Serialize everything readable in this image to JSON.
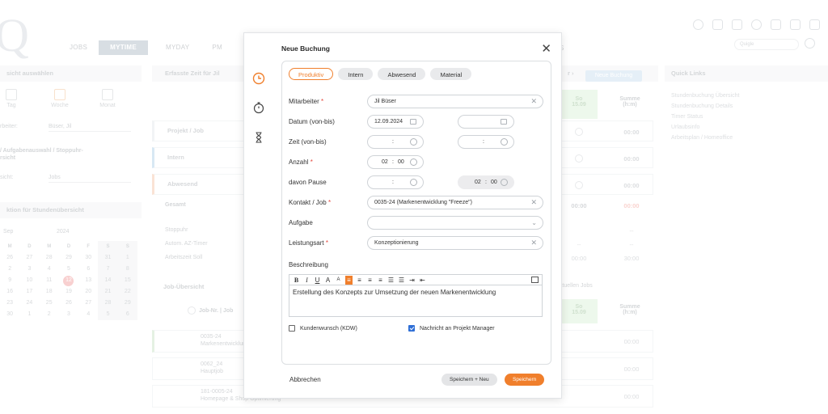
{
  "app": {
    "logo": "Q",
    "nav": [
      "JOBS",
      "MYTIME",
      "MYDAY",
      "PM",
      "S"
    ],
    "quick_search_placeholder": "Quigle"
  },
  "left_panel": {
    "header": "sicht auswählen",
    "views": [
      "Tag",
      "Woche",
      "Monat"
    ],
    "mitarbeiter_label": "rbeiter:",
    "mitarbeiter_value": "Büser, Jil",
    "aufgaben_header": "/ Aufgabenauswahl / Stoppuhr-",
    "aufgaben_sub": "rsicht",
    "ansicht_label": "sicht:",
    "ansicht_value": "Jobs",
    "section_header": "ktion für Stundenübersicht",
    "calendar": {
      "month": "Sep",
      "year": "2024",
      "weekdays": [
        "M",
        "D",
        "M",
        "D",
        "F",
        "S",
        "S"
      ],
      "weeks": [
        [
          "26",
          "27",
          "28",
          "29",
          "30",
          "31",
          "1"
        ],
        [
          "2",
          "3",
          "4",
          "5",
          "6",
          "7",
          "8"
        ],
        [
          "9",
          "10",
          "11",
          "12",
          "13",
          "14",
          "15"
        ],
        [
          "16",
          "17",
          "18",
          "19",
          "20",
          "21",
          "22"
        ],
        [
          "23",
          "24",
          "25",
          "26",
          "27",
          "28",
          "29"
        ],
        [
          "30",
          "1",
          "2",
          "3",
          "4",
          "5",
          "6"
        ]
      ],
      "today": "12"
    }
  },
  "main": {
    "header": "Erfasste Zeit für Jil",
    "nav_arrow": "r ›",
    "neue_buchung_btn": "Neue Buchung",
    "col_so": "So",
    "col_so_date": "15.09",
    "col_summe": "Summe",
    "col_summe_unit": "(h:m)",
    "rows": [
      {
        "label": "Projekt / Job",
        "so": "",
        "sum": "00:00"
      },
      {
        "label": "Intern",
        "so": "",
        "sum": "00:00"
      },
      {
        "label": "Abwesend",
        "so": "",
        "sum": "00:00"
      }
    ],
    "gesamt_label": "Gesamt",
    "gesamt_so": "00:00",
    "gesamt_sum": "00:00",
    "stoppuhr": "Stoppuhr",
    "autom": "Autom. AZ-Timer",
    "arbeitszeit": "Arbeitszeit Soll",
    "stoppuhr_dash": "--",
    "autom_so": "--",
    "autom_sum": "--",
    "soll_so": "00:00",
    "soll_sum": "30:00",
    "job_uebersicht": "Job-Übersicht",
    "aktuelle_jobs": "aktuellen Jobs",
    "job_col": "Job-Nr. | Job",
    "jobs": [
      {
        "nr": "0035-24",
        "name": "Markenentwicklung",
        "sum": "00:00"
      },
      {
        "nr": "0062_24",
        "name": "Hauptjob",
        "sum": "00:00"
      },
      {
        "nr": "181-0005-24",
        "name": "Homepage & Shop Optimierung",
        "sum": "00:00"
      }
    ]
  },
  "quick_links": {
    "header": "Quick Links",
    "items": [
      "Stundenbuchung Übersicht",
      "Stundenbuchung Details",
      "Timer Status",
      "Urlaubsinfo",
      "Arbeitsplan / Homeoffice"
    ]
  },
  "modal": {
    "title": "Neue Buchung",
    "tabs": [
      "Produktiv",
      "Intern",
      "Abwesend",
      "Material"
    ],
    "active_tab": "Produktiv",
    "fields": {
      "mitarbeiter_label": "Mitarbeiter",
      "mitarbeiter_value": "Jil Büser",
      "datum_label": "Datum (von-bis)",
      "datum_von": "12.09.2024",
      "datum_bis": "",
      "zeit_label": "Zeit (von-bis)",
      "zeit_von": ":",
      "zeit_bis": ":",
      "anzahl_label": "Anzahl",
      "anzahl_h": "02",
      "anzahl_sep": ":",
      "anzahl_m": "00",
      "pause_label": "davon Pause",
      "pause_von": ":",
      "pause_h": "02",
      "pause_sep": ":",
      "pause_m": "00",
      "kontakt_label": "Kontakt / Job",
      "kontakt_value": "0035-24 (Markenentwicklung \"Freeze\")",
      "aufgabe_label": "Aufgabe",
      "aufgabe_value": "",
      "leistungsart_label": "Leistungsart",
      "leistungsart_value": "Konzeptionierung",
      "beschreibung_label": "Beschreibung",
      "beschreibung_value": "Erstellung des Konzepts zur Umsetzung der neuen Markenentwicklung",
      "required_mark": "*"
    },
    "checkboxes": {
      "kundenwunsch": "Kundenwunsch (KDW)",
      "kundenwunsch_checked": false,
      "nachricht": "Nachricht an Projekt Manager",
      "nachricht_checked": true
    },
    "buttons": {
      "cancel": "Abbrechen",
      "save_new": "Speichern + Neu",
      "save": "Speichern"
    },
    "accent_color": "#f07f2c"
  }
}
